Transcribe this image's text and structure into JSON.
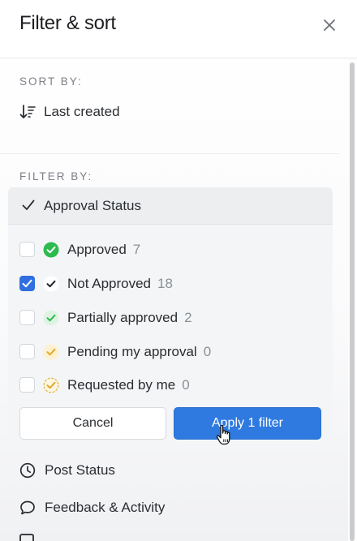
{
  "header": {
    "title": "Filter & sort",
    "close_icon": "close-icon"
  },
  "sort": {
    "label": "SORT BY:",
    "current": "Last created",
    "icon": "sort-descending-icon"
  },
  "filter": {
    "label": "FILTER BY:",
    "group": {
      "title": "Approval Status",
      "expanded": true,
      "options": [
        {
          "label": "Approved",
          "count": "7",
          "checked": false,
          "icon": "approved-icon"
        },
        {
          "label": "Not Approved",
          "count": "18",
          "checked": true,
          "icon": "not-approved-icon"
        },
        {
          "label": "Partially approved",
          "count": "2",
          "checked": false,
          "icon": "partially-approved-icon"
        },
        {
          "label": "Pending my approval",
          "count": "0",
          "checked": false,
          "icon": "pending-icon"
        },
        {
          "label": "Requested by me",
          "count": "0",
          "checked": false,
          "icon": "requested-icon"
        }
      ],
      "cancel_label": "Cancel",
      "apply_label": "Apply 1 filter"
    },
    "more": [
      {
        "label": "Post Status",
        "icon": "clock-icon"
      },
      {
        "label": "Feedback & Activity",
        "icon": "comment-icon"
      }
    ]
  },
  "colors": {
    "accent": "#2f7ae0",
    "approved_green": "#2dba4e",
    "pending_yellow": "#f0c040"
  }
}
